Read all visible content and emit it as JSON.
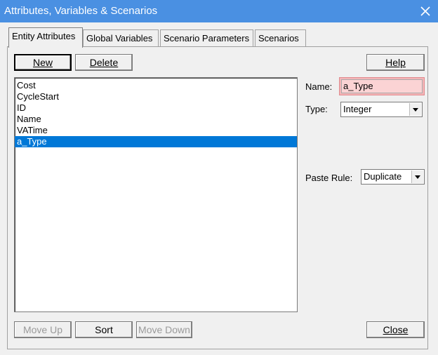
{
  "window": {
    "title": "Attributes, Variables & Scenarios"
  },
  "tabs": [
    {
      "label": "Entity Attributes",
      "active": true
    },
    {
      "label": "Global Variables",
      "active": false
    },
    {
      "label": "Scenario Parameters",
      "active": false
    },
    {
      "label": "Scenarios",
      "active": false
    }
  ],
  "toolbar": {
    "new_label": "New",
    "delete_label": "Delete",
    "help_label": "Help"
  },
  "list": {
    "items": [
      "Cost",
      "CycleStart",
      "ID",
      "Name",
      "VATime",
      "a_Type"
    ],
    "selected": "a_Type"
  },
  "fields": {
    "name_label": "Name:",
    "name_value": "a_Type",
    "type_label": "Type:",
    "type_value": "Integer",
    "paste_rule_label": "Paste Rule:",
    "paste_rule_value": "Duplicate"
  },
  "bottom": {
    "move_up_label": "Move Up",
    "sort_label": "Sort",
    "move_down_label": "Move Down",
    "close_label": "Close"
  },
  "colors": {
    "titlebar": "#4a90e2",
    "selection": "#0078d7",
    "name_highlight": "#f4b6b8"
  }
}
